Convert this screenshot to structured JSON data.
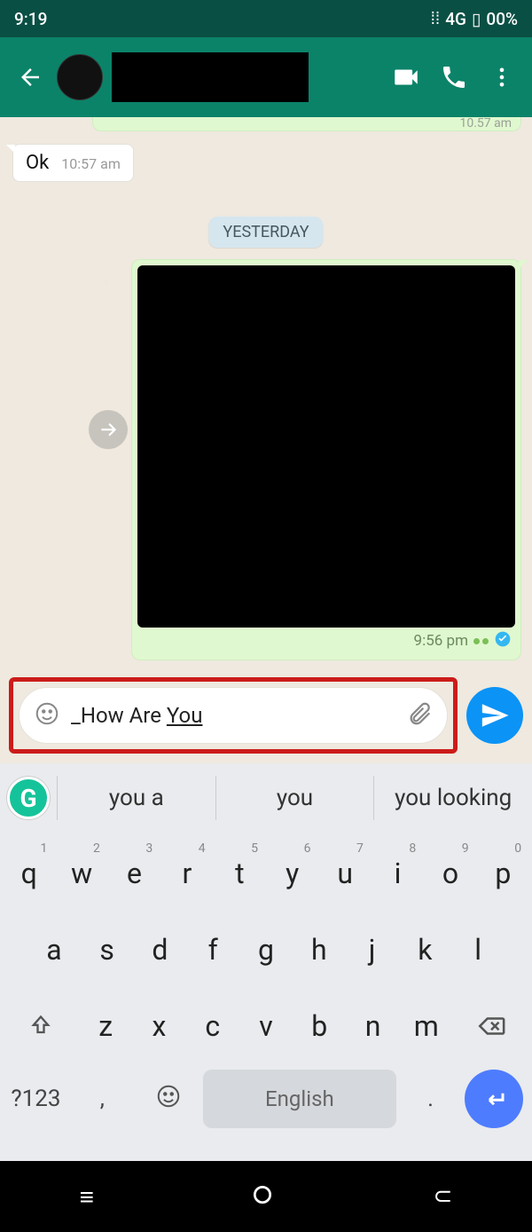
{
  "status": {
    "time": "9:19",
    "net": "4G",
    "battery": "00%"
  },
  "chat": {
    "partial_time": "10.57 am",
    "ok_text": "Ok",
    "ok_time": "10:57 am",
    "date_chip": "YESTERDAY",
    "media_time": "9:56 pm"
  },
  "input": {
    "prefix": "_How Are ",
    "underlined": "You"
  },
  "suggestions": [
    "you a",
    "you",
    "you looking"
  ],
  "keyboard": {
    "row1": [
      {
        "k": "q",
        "n": "1"
      },
      {
        "k": "w",
        "n": "2"
      },
      {
        "k": "e",
        "n": "3"
      },
      {
        "k": "r",
        "n": "4"
      },
      {
        "k": "t",
        "n": "5"
      },
      {
        "k": "y",
        "n": "6"
      },
      {
        "k": "u",
        "n": "7"
      },
      {
        "k": "i",
        "n": "8"
      },
      {
        "k": "o",
        "n": "9"
      },
      {
        "k": "p",
        "n": "0"
      }
    ],
    "row2": [
      "a",
      "s",
      "d",
      "f",
      "g",
      "h",
      "j",
      "k",
      "l"
    ],
    "row3": [
      "z",
      "x",
      "c",
      "v",
      "b",
      "n",
      "m"
    ],
    "symkey": "?123",
    "comma": ",",
    "space": "English",
    "period": "."
  }
}
